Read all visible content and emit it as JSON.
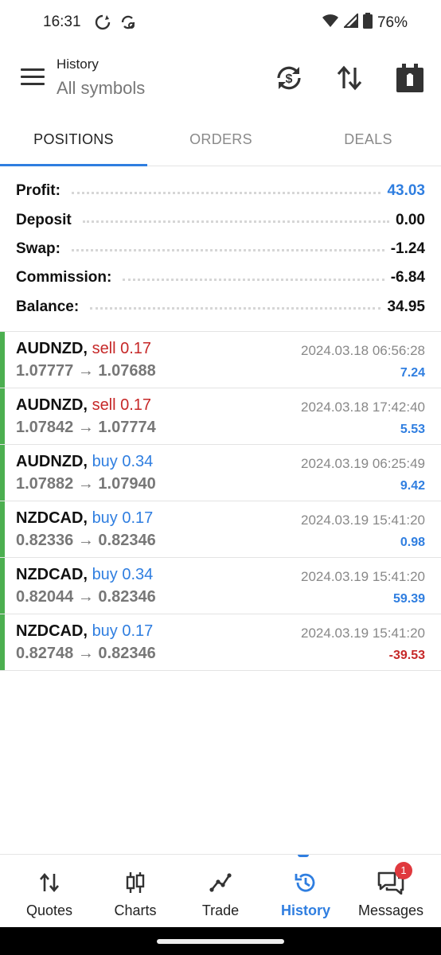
{
  "status_bar": {
    "time": "16:31",
    "battery": "76%"
  },
  "header": {
    "title": "History",
    "subtitle": "All symbols"
  },
  "tabs": [
    {
      "label": "POSITIONS",
      "active": true
    },
    {
      "label": "ORDERS",
      "active": false
    },
    {
      "label": "DEALS",
      "active": false
    }
  ],
  "summary": [
    {
      "label": "Profit:",
      "value": "43.03"
    },
    {
      "label": "Deposit",
      "value": "0.00"
    },
    {
      "label": "Swap:",
      "value": "-1.24"
    },
    {
      "label": "Commission:",
      "value": "-6.84"
    },
    {
      "label": "Balance:",
      "value": "34.95"
    }
  ],
  "positions": [
    {
      "symbol": "AUDNZD,",
      "side": "sell 0.17",
      "prices": "1.07777 → 1.07688",
      "time": "2024.03.18 06:56:28",
      "profit": "7.24"
    },
    {
      "symbol": "AUDNZD,",
      "side": "sell 0.17",
      "prices": "1.07842 → 1.07774",
      "time": "2024.03.18 17:42:40",
      "profit": "5.53"
    },
    {
      "symbol": "AUDNZD,",
      "side": "buy 0.34",
      "prices": "1.07882 → 1.07940",
      "time": "2024.03.19 06:25:49",
      "profit": "9.42"
    },
    {
      "symbol": "NZDCAD,",
      "side": "buy 0.17",
      "prices": "0.82336 → 0.82346",
      "time": "2024.03.19 15:41:20",
      "profit": "0.98"
    },
    {
      "symbol": "NZDCAD,",
      "side": "buy 0.34",
      "prices": "0.82044 → 0.82346",
      "time": "2024.03.19 15:41:20",
      "profit": "59.39"
    },
    {
      "symbol": "NZDCAD,",
      "side": "buy 0.17",
      "prices": "0.82748 → 0.82346",
      "time": "2024.03.19 15:41:20",
      "profit": "-39.53"
    }
  ],
  "bottom_nav": [
    {
      "label": "Quotes",
      "icon": "quotes-arrows-icon"
    },
    {
      "label": "Charts",
      "icon": "candlestick-icon"
    },
    {
      "label": "Trade",
      "icon": "trade-line-icon"
    },
    {
      "label": "History",
      "icon": "history-clock-icon",
      "active": true
    },
    {
      "label": "Messages",
      "icon": "chat-bubbles-icon",
      "badge": "1"
    }
  ],
  "colors": {
    "accent": "#2f7ee0",
    "sell": "#c62828",
    "position_bar": "#4caf50",
    "badge": "#e0393e"
  }
}
